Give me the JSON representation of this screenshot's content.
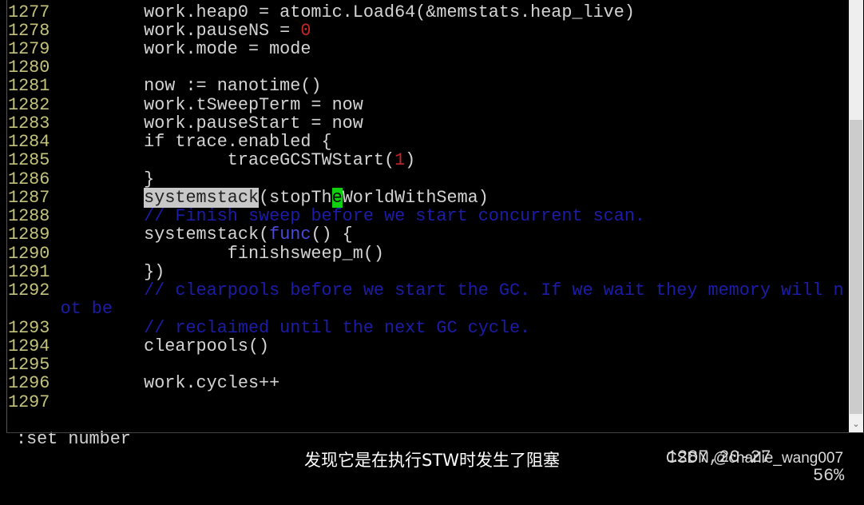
{
  "editor": {
    "lines": [
      {
        "num": "1277",
        "segments": [
          {
            "t": "        work.heap0 = atomic.Load64(&memstats.heap_live)",
            "c": ""
          }
        ]
      },
      {
        "num": "1278",
        "segments": [
          {
            "t": "        work.pauseNS = ",
            "c": ""
          },
          {
            "t": "0",
            "c": "num"
          }
        ]
      },
      {
        "num": "1279",
        "segments": [
          {
            "t": "        work.mode = mode",
            "c": ""
          }
        ]
      },
      {
        "num": "1280",
        "segments": []
      },
      {
        "num": "1281",
        "segments": [
          {
            "t": "        now := nanotime()",
            "c": ""
          }
        ]
      },
      {
        "num": "1282",
        "segments": [
          {
            "t": "        work.tSweepTerm = now",
            "c": ""
          }
        ]
      },
      {
        "num": "1283",
        "segments": [
          {
            "t": "        work.pauseStart = now",
            "c": ""
          }
        ]
      },
      {
        "num": "1284",
        "segments": [
          {
            "t": "        if trace.enabled {",
            "c": ""
          }
        ]
      },
      {
        "num": "1285",
        "segments": [
          {
            "t": "                traceGCSTWStart(",
            "c": ""
          },
          {
            "t": "1",
            "c": "num"
          },
          {
            "t": ")",
            "c": ""
          }
        ]
      },
      {
        "num": "1286",
        "segments": [
          {
            "t": "        }",
            "c": ""
          }
        ]
      },
      {
        "num": "1287",
        "segments": [
          {
            "t": "        ",
            "c": ""
          },
          {
            "t": "systemstack",
            "c": "hl"
          },
          {
            "t": "(stopTh",
            "c": ""
          },
          {
            "t": "e",
            "c": "cursor"
          },
          {
            "t": "WorldWithSema)",
            "c": ""
          }
        ]
      },
      {
        "num": "1288",
        "segments": [
          {
            "t": "        // Finish sweep before we start concurrent scan.",
            "c": "comment"
          }
        ]
      },
      {
        "num": "1289",
        "segments": [
          {
            "t": "        systemstack(",
            "c": ""
          },
          {
            "t": "func",
            "c": "kw"
          },
          {
            "t": "() {",
            "c": ""
          }
        ]
      },
      {
        "num": "1290",
        "segments": [
          {
            "t": "                finishsweep_m()",
            "c": ""
          }
        ]
      },
      {
        "num": "1291",
        "segments": [
          {
            "t": "        })",
            "c": ""
          }
        ]
      },
      {
        "num": "1292",
        "segments": [
          {
            "t": "        // clearpools before we start the GC. If we wait they memory will n",
            "c": "comment"
          }
        ]
      },
      {
        "num": "",
        "segments": [
          {
            "t": "ot be",
            "c": "comment"
          }
        ]
      },
      {
        "num": "1293",
        "segments": [
          {
            "t": "        // reclaimed until the next GC cycle.",
            "c": "comment"
          }
        ]
      },
      {
        "num": "1294",
        "segments": [
          {
            "t": "        clearpools()",
            "c": ""
          }
        ]
      },
      {
        "num": "1295",
        "segments": []
      },
      {
        "num": "1296",
        "segments": [
          {
            "t": "        work.cycles++",
            "c": ""
          }
        ]
      },
      {
        "num": "1297",
        "segments": []
      }
    ],
    "status": {
      "command": ":set number",
      "position": "1287,20-27",
      "percent": "56%"
    },
    "scroll_position_percent": 56
  },
  "video": {
    "subtitle": "发现它是在执行STW时发生了阻塞",
    "watermark": "CSDN @charlie_wang007"
  },
  "colors": {
    "line_number": "#c4c27a",
    "comment": "#1c1ca8",
    "number_literal": "#c02828",
    "search_highlight": "#c8c8c8",
    "cursor": "#10d010"
  }
}
